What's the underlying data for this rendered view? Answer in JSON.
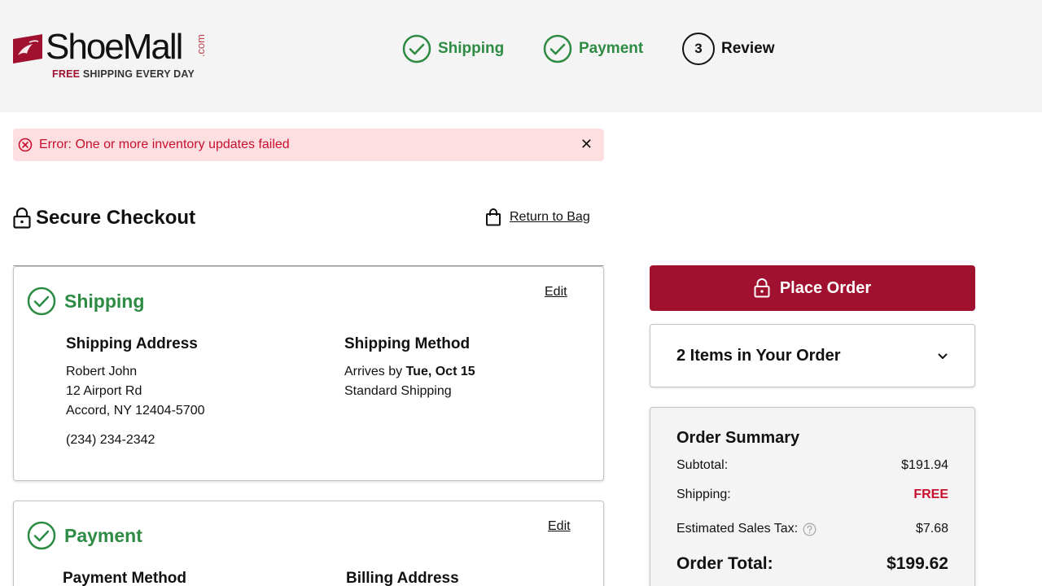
{
  "brand": {
    "name": "ShoeMall",
    "dotcom": ".com",
    "tagline_free": "FREE",
    "tagline_rest": " SHIPPING EVERY DAY",
    "color": "#a0102f"
  },
  "steps": [
    {
      "label": "Shipping",
      "state": "done",
      "icon": "check-circle-icon"
    },
    {
      "label": "Payment",
      "state": "done",
      "icon": "check-circle-icon"
    },
    {
      "number": "3",
      "label": "Review",
      "state": "current"
    }
  ],
  "error": {
    "message": "Error: One or more inventory updates failed",
    "close_glyph": "✕",
    "color": "#c8102e",
    "background": "#fddfe1"
  },
  "checkout": {
    "title": "Secure Checkout",
    "return_label": "Return to Bag"
  },
  "shipping": {
    "title": "Shipping",
    "edit_label": "Edit",
    "address_title": "Shipping Address",
    "address_lines": [
      "Robert John",
      "12 Airport Rd",
      "Accord, NY 12404-5700"
    ],
    "phone": "(234) 234-2342",
    "method_title": "Shipping Method",
    "arrives_prefix": "Arrives by ",
    "arrives_date": "Tue, Oct 15",
    "method_name": "Standard Shipping"
  },
  "payment": {
    "title": "Payment",
    "edit_label": "Edit",
    "method_title": "Payment Method",
    "billing_title": "Billing Address"
  },
  "order": {
    "place_order_label": "Place Order",
    "items_label": "2 Items in Your Order"
  },
  "summary": {
    "title": "Order Summary",
    "subtotal_label": "Subtotal:",
    "subtotal_value": "$191.94",
    "shipping_label": "Shipping:",
    "shipping_value": "FREE",
    "tax_label": "Estimated Sales Tax:",
    "tax_value": "$7.68",
    "total_label": "Order Total:",
    "total_value": "$199.62"
  },
  "colors": {
    "success": "#2e8b44",
    "accent": "#a0102f",
    "header_bg": "#f4f4f4"
  }
}
